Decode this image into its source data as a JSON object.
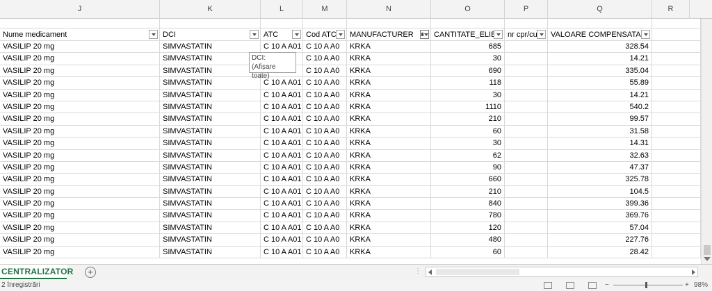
{
  "column_letters": [
    "J",
    "K",
    "L",
    "M",
    "N",
    "O",
    "P",
    "Q",
    "R"
  ],
  "headers": {
    "nume": "Nume medicament",
    "dci": "DCI",
    "atc": "ATC",
    "cod_atc": "Cod ATC",
    "manufacturer": "MANUFACTURER",
    "cantitate": "CANTITATE_ELIB",
    "nr": "nr cpr/cu",
    "valoare": "VALOARE COMPENSATA"
  },
  "rows": [
    {
      "nume": "VASILIP 20 mg",
      "dci": "SIMVASTATIN",
      "atc": "C 10 A A01",
      "cod": "C 10 A A0",
      "man": "KRKA",
      "cant": "685",
      "val": "328.54"
    },
    {
      "nume": "VASILIP 20 mg",
      "dci": "SIMVASTATIN",
      "atc": "",
      "cod": "C 10 A A0",
      "man": "KRKA",
      "cant": "30",
      "val": "14.21"
    },
    {
      "nume": "VASILIP 20 mg",
      "dci": "SIMVASTATIN",
      "atc": "",
      "cod": "C 10 A A0",
      "man": "KRKA",
      "cant": "690",
      "val": "335.04"
    },
    {
      "nume": "VASILIP 20 mg",
      "dci": "SIMVASTATIN",
      "atc": "C 10 A A01",
      "cod": "C 10 A A0",
      "man": "KRKA",
      "cant": "118",
      "val": "55.89"
    },
    {
      "nume": "VASILIP 20 mg",
      "dci": "SIMVASTATIN",
      "atc": "C 10 A A01",
      "cod": "C 10 A A0",
      "man": "KRKA",
      "cant": "30",
      "val": "14.21"
    },
    {
      "nume": "VASILIP 20 mg",
      "dci": "SIMVASTATIN",
      "atc": "C 10 A A01",
      "cod": "C 10 A A0",
      "man": "KRKA",
      "cant": "1110",
      "val": "540.2"
    },
    {
      "nume": "VASILIP 20 mg",
      "dci": "SIMVASTATIN",
      "atc": "C 10 A A01",
      "cod": "C 10 A A0",
      "man": "KRKA",
      "cant": "210",
      "val": "99.57"
    },
    {
      "nume": "VASILIP 20 mg",
      "dci": "SIMVASTATIN",
      "atc": "C 10 A A01",
      "cod": "C 10 A A0",
      "man": "KRKA",
      "cant": "60",
      "val": "31.58"
    },
    {
      "nume": "VASILIP 20 mg",
      "dci": "SIMVASTATIN",
      "atc": "C 10 A A01",
      "cod": "C 10 A A0",
      "man": "KRKA",
      "cant": "30",
      "val": "14.31"
    },
    {
      "nume": "VASILIP 20 mg",
      "dci": "SIMVASTATIN",
      "atc": "C 10 A A01",
      "cod": "C 10 A A0",
      "man": "KRKA",
      "cant": "62",
      "val": "32.63"
    },
    {
      "nume": "VASILIP 20 mg",
      "dci": "SIMVASTATIN",
      "atc": "C 10 A A01",
      "cod": "C 10 A A0",
      "man": "KRKA",
      "cant": "90",
      "val": "47.37"
    },
    {
      "nume": "VASILIP 20 mg",
      "dci": "SIMVASTATIN",
      "atc": "C 10 A A01",
      "cod": "C 10 A A0",
      "man": "KRKA",
      "cant": "660",
      "val": "325.78"
    },
    {
      "nume": "VASILIP 20 mg",
      "dci": "SIMVASTATIN",
      "atc": "C 10 A A01",
      "cod": "C 10 A A0",
      "man": "KRKA",
      "cant": "210",
      "val": "104.5"
    },
    {
      "nume": "VASILIP 20 mg",
      "dci": "SIMVASTATIN",
      "atc": "C 10 A A01",
      "cod": "C 10 A A0",
      "man": "KRKA",
      "cant": "840",
      "val": "399.36"
    },
    {
      "nume": "VASILIP 20 mg",
      "dci": "SIMVASTATIN",
      "atc": "C 10 A A01",
      "cod": "C 10 A A0",
      "man": "KRKA",
      "cant": "780",
      "val": "369.76"
    },
    {
      "nume": "VASILIP 20 mg",
      "dci": "SIMVASTATIN",
      "atc": "C 10 A A01",
      "cod": "C 10 A A0",
      "man": "KRKA",
      "cant": "120",
      "val": "57.04"
    },
    {
      "nume": "VASILIP 20 mg",
      "dci": "SIMVASTATIN",
      "atc": "C 10 A A01",
      "cod": "C 10 A A0",
      "man": "KRKA",
      "cant": "480",
      "val": "227.76"
    },
    {
      "nume": "VASILIP 20 mg",
      "dci": "SIMVASTATIN",
      "atc": "C 10 A A01",
      "cod": "C 10 A A0",
      "man": "KRKA",
      "cant": "60",
      "val": "28.42"
    }
  ],
  "tooltip": {
    "title": "DCI:",
    "text": "(Afișare toate)"
  },
  "sheet_tab": "CENTRALIZATOR",
  "add_sheet": "+",
  "status": {
    "records": "2 înregistrări",
    "zoom": "98%",
    "minus": "−",
    "plus": "+"
  },
  "colors": {
    "sheet_tab_accent": "#217346"
  }
}
